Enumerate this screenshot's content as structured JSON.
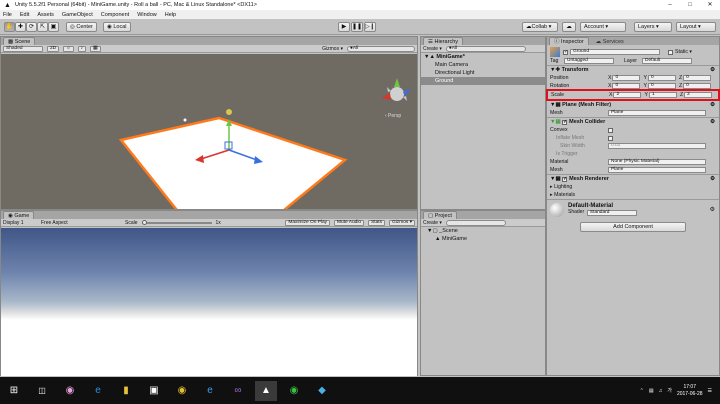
{
  "window": {
    "title": "Unity 5.5.2f1 Personal (64bit) - MiniGame.unity - Roll a ball - PC, Mac & Linux Standalone* <DX11>"
  },
  "menu": [
    "File",
    "Edit",
    "Assets",
    "GameObject",
    "Component",
    "Window",
    "Help"
  ],
  "toolbar": {
    "pivot_label": "Center",
    "space_label": "Local",
    "collab_label": "Collab ▾",
    "account_label": "Account ▾",
    "layers_label": "Layers ▾",
    "layout_label": "Layout ▾"
  },
  "scene": {
    "tab": "Scene",
    "shading": "Shaded",
    "mode_2d": "2D",
    "gizmos": "Gizmos ▾",
    "search_placeholder": "●All",
    "persp": "‹ Persp"
  },
  "game": {
    "tab": "Game",
    "display": "Display 1",
    "aspect": "Free Aspect",
    "scale_label": "Scale",
    "scale_value": "1x",
    "options": [
      "Maximize On Play",
      "Mute Audio",
      "Stats",
      "Gizmos ▾"
    ]
  },
  "hierarchy": {
    "tab": "Hierarchy",
    "create": "Create ▾",
    "search_placeholder": "●All",
    "root": "MiniGame*",
    "items": [
      "Main Camera",
      "Directional Light",
      "Ground"
    ]
  },
  "project": {
    "tab": "Project",
    "create": "Create ▾",
    "folder": "_Scene",
    "item": "MiniGame"
  },
  "inspector": {
    "tabs": [
      "Inspector",
      "Services"
    ],
    "object_name": "Ground",
    "static_label": "Static ▾",
    "tag_label": "Tag",
    "tag_value": "Untagged",
    "layer_label": "Layer",
    "layer_value": "Default",
    "transform": {
      "title": "Transform",
      "position": {
        "label": "Position",
        "x": "0",
        "y": "0",
        "z": "0"
      },
      "rotation": {
        "label": "Rotation",
        "x": "0",
        "y": "0",
        "z": "0"
      },
      "scale": {
        "label": "Scale",
        "x": "2",
        "y": "1",
        "z": "2"
      }
    },
    "mesh_filter": {
      "title": "Plane (Mesh Filter)",
      "mesh_label": "Mesh",
      "mesh_value": "Plane"
    },
    "mesh_collider": {
      "title": "Mesh Collider",
      "convex": "Convex",
      "inflate": "Inflate Mesh",
      "skin_label": "Skin Width",
      "skin_value": "0.01",
      "trigger": "Is Trigger",
      "material_label": "Material",
      "material_value": "None (Physic Material)",
      "mesh_label": "Mesh",
      "mesh_value": "Plane"
    },
    "mesh_renderer": {
      "title": "Mesh Renderer",
      "lighting": "Lighting",
      "materials": "Materials"
    },
    "material": {
      "name": "Default-Material",
      "shader_label": "Shader",
      "shader_value": "Standard"
    },
    "add_component": "Add Component"
  },
  "highlight_color": "#e0101b",
  "taskbar": {
    "time": "17:07",
    "date": "2017-06-28",
    "ime": "가",
    "lang": "⌃"
  }
}
